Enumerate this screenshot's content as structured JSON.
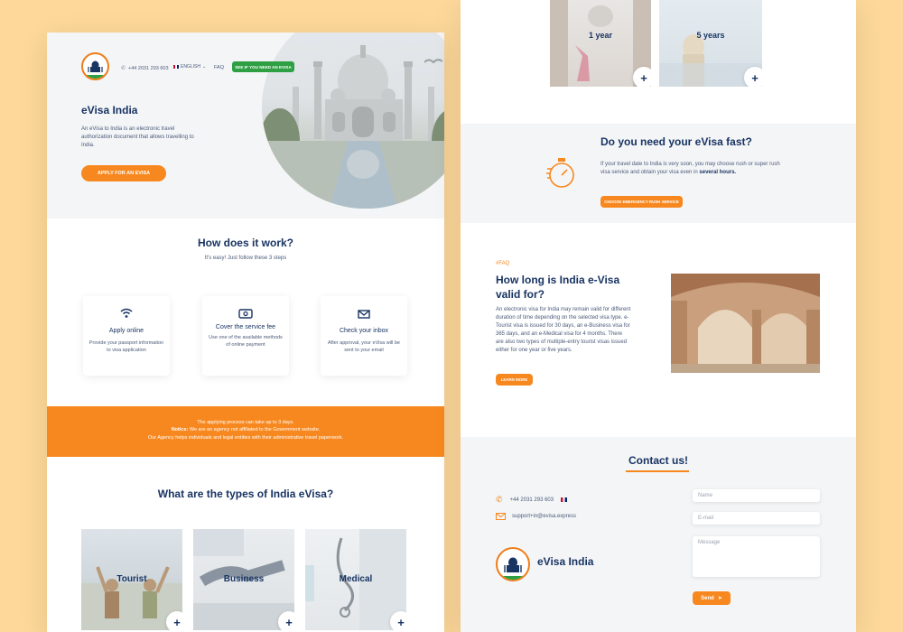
{
  "header": {
    "phone": "+44 2031 293 603",
    "language": "ENGLISH",
    "faq": "FAQ",
    "cta": "SEE IF YOU NEED AN EVISA"
  },
  "hero": {
    "title": "eVisa India",
    "description": "An eVisa to India is an electronic travel authorization document that allows travelling to India.",
    "button": "APPLY FOR AN EVISA"
  },
  "how": {
    "title": "How does it work?",
    "subtitle": "It's easy! Just follow these 3 steps",
    "steps": [
      {
        "title": "Apply online",
        "desc": "Provide your passport information to visa application",
        "icon": "wifi-icon"
      },
      {
        "title": "Cover the service fee",
        "desc": "Use one of the available methods of online payment",
        "icon": "money-icon"
      },
      {
        "title": "Check your inbox",
        "desc": "After approval, your eVisa will be sent to your email",
        "icon": "envelope-icon"
      }
    ]
  },
  "notice": {
    "line1": "The applying process can take up to 3 days.",
    "notice_label": "Notice:",
    "line2": "We are an agency not affiliated to the Government website.",
    "line3": "Our Agency helps individuals and legal entities with their administrative travel paperwork."
  },
  "types": {
    "title": "What are the types of India eVisa?",
    "items": [
      "Tourist",
      "Business",
      "Medical"
    ],
    "plus": "+"
  },
  "validity_cards": [
    "1 year",
    "5 years"
  ],
  "rush": {
    "title": "Do you need your eVisa fast?",
    "text": "If your travel date to India is very soon, you may choose rush or super rush visa service and obtain your visa even in",
    "bold": "several hours.",
    "button": "CHOOSE EMERGENCY RUSH SERVICE"
  },
  "faq": {
    "tag": "#FAQ",
    "title": "How long is India e-Visa valid for?",
    "text": "An electronic visa for India may remain valid for different duration of time depending on the selected visa type. e-Tourist visa is issued for 30 days, an e-Business visa for 365 days, and an e-Medical visa for 4 months. There are also two types of multiple-entry tourist visas issued either for one year or five years.",
    "button": "LEARN MORE"
  },
  "contact": {
    "title": "Contact us!",
    "phone": "+44 2031 293 603",
    "email": "support+in@evisa.express",
    "brand": "eVisa India",
    "name_placeholder": "Name",
    "email_placeholder": "E-mail",
    "message_placeholder": "Message",
    "send": "Send"
  },
  "colors": {
    "background": "#fdd89a",
    "orange": "#f7881f",
    "navy": "#183463",
    "green": "#2ea043"
  }
}
